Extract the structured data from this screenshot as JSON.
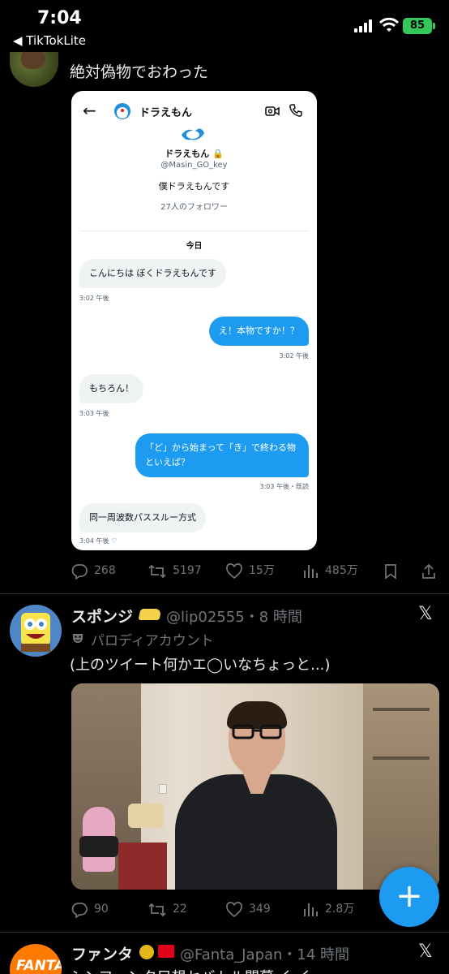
{
  "status_bar": {
    "time": "7:04",
    "back_app": "◀ TikTokLite",
    "battery": "85"
  },
  "tweet1": {
    "text": "絶対偽物でおわった",
    "dm": {
      "header_name": "ドラえもん",
      "profile_name": "ドラえもん",
      "handle": "@Masin_GO_key",
      "bio": "僕ドラえもんです",
      "followers": "27人のフォロワー",
      "date_divider": "今日",
      "messages": [
        {
          "dir": "in",
          "text": "こんにちは ぼくドラえもんです",
          "meta": "3:02 午後"
        },
        {
          "dir": "out",
          "text": "え！本物ですか！？",
          "meta": "3:02 午後"
        },
        {
          "dir": "in",
          "text": "もちろん！",
          "meta": "3:03 午後"
        },
        {
          "dir": "out",
          "text": "「ど」から始まって「き」で終わる物といえば？",
          "meta": "3:03 午後・既読"
        },
        {
          "dir": "in",
          "text": "同一周波数パススルー方式",
          "meta": "3:04 午後"
        }
      ]
    },
    "actions": {
      "replies": "268",
      "retweets": "5197",
      "likes": "15万",
      "views": "485万"
    }
  },
  "tweet2": {
    "name": "スポンジ",
    "handle": "@lip02555・8 時間",
    "parody_label": "パロディアカウント",
    "text": "(上のツイート何かエ◯いなちょっと...)",
    "actions": {
      "replies": "90",
      "retweets": "22",
      "likes": "349",
      "views": "2.8万"
    }
  },
  "tweet3": {
    "name": "ファンタ",
    "handle": "@Fanta_Japan・14 時間",
    "avatar_text": "FANTA",
    "text": "シンファンタ只想セバトル開幕 く く"
  },
  "fab": {
    "label": "+"
  },
  "colors": {
    "accent": "#1d9bf0",
    "background": "#000000",
    "secondary_text": "#71767b"
  }
}
